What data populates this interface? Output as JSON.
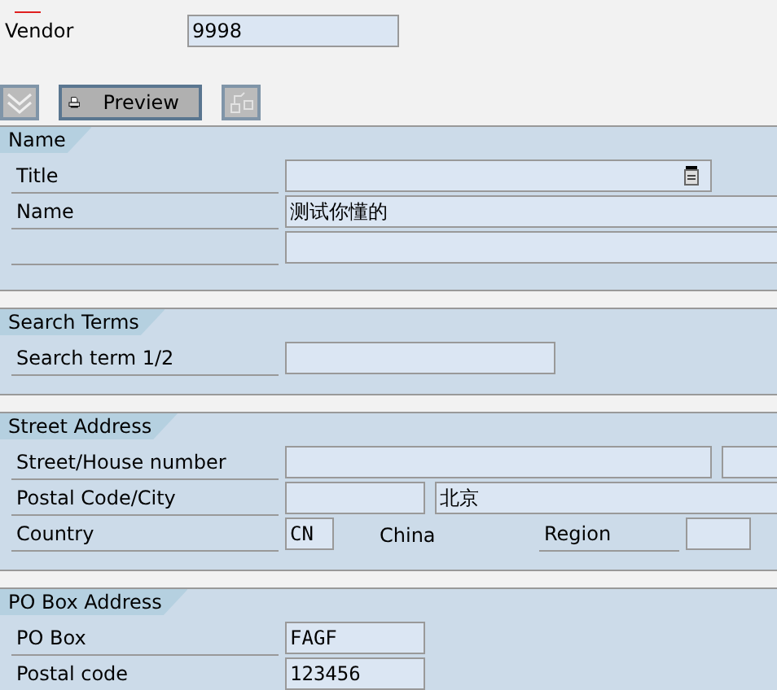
{
  "vendor": {
    "label": "Vendor",
    "value": "9998",
    "required": true
  },
  "toolbar": [
    {
      "kind": "funnel",
      "disabled": true
    },
    {
      "kind": "print",
      "label": "Preview",
      "disabled": false
    },
    {
      "kind": "hierarchy",
      "disabled": true
    }
  ],
  "sections": [
    {
      "title": "Name",
      "rows": [
        {
          "label": "Title",
          "items": [
            {
              "kind": "field",
              "help": true
            }
          ]
        },
        {
          "label": "Name",
          "items": [
            {
              "kind": "field",
              "value": "测试你懂的"
            }
          ]
        },
        {
          "items": [
            {
              "kind": "field"
            }
          ]
        }
      ]
    },
    {
      "title": "Search Terms",
      "rows": [
        {
          "label": "Search term 1/2",
          "items": [
            {
              "kind": "field"
            }
          ]
        }
      ]
    },
    {
      "title": "Street Address",
      "rows": [
        {
          "label": "Street/House number",
          "items": [
            {
              "kind": "field"
            },
            {
              "kind": "field"
            }
          ]
        },
        {
          "label": "Postal Code/City",
          "items": [
            {
              "kind": "field"
            },
            {
              "kind": "field",
              "value": "北京"
            }
          ]
        },
        {
          "label": "Country",
          "items": [
            {
              "kind": "field",
              "value": "CN"
            },
            {
              "kind": "text",
              "text": "China"
            },
            {
              "kind": "label",
              "text": "Region"
            },
            {
              "kind": "field"
            }
          ]
        }
      ]
    },
    {
      "title": "PO Box Address",
      "rows": [
        {
          "label": "PO Box",
          "items": [
            {
              "kind": "field",
              "value": "FAGF"
            }
          ]
        },
        {
          "label": "Postal code",
          "items": [
            {
              "kind": "field",
              "value": "123456"
            }
          ]
        }
      ]
    }
  ]
}
